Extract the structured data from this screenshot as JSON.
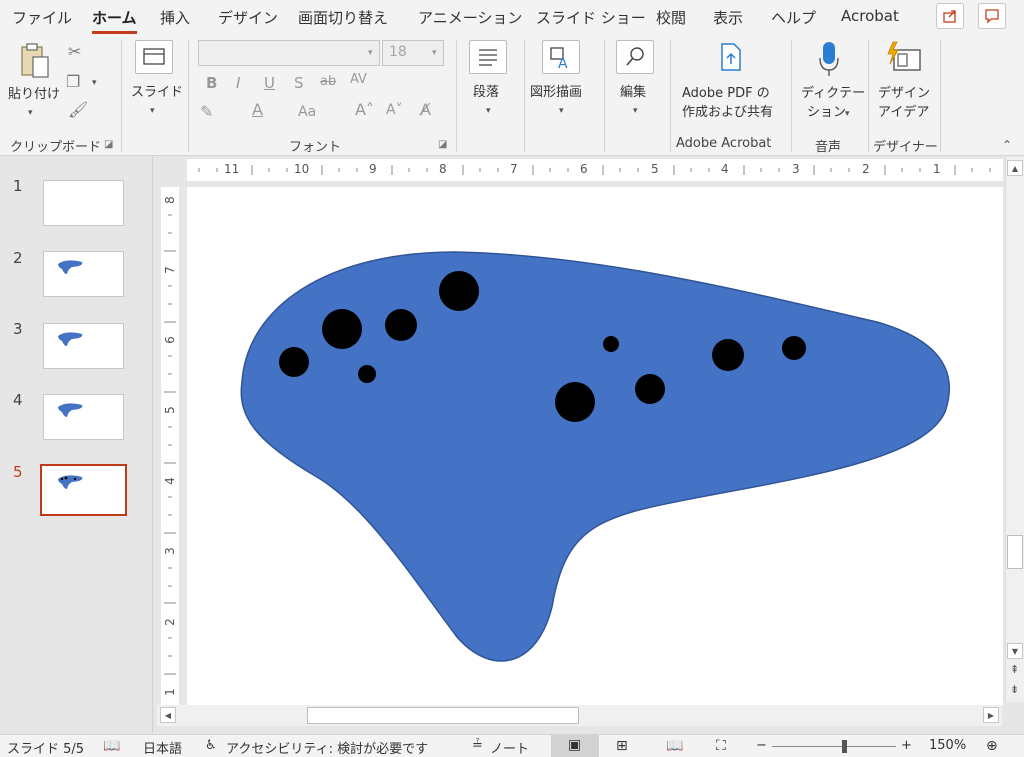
{
  "menu": {
    "tabs": [
      "ファイル",
      "ホーム",
      "挿入",
      "デザイン",
      "画面切り替え",
      "アニメーション",
      "スライド ショー",
      "校閲",
      "表示",
      "ヘルプ",
      "Acrobat"
    ],
    "active_tab": "ホーム"
  },
  "ribbon": {
    "clipboard": {
      "paste_label": "貼り付け",
      "group_label": "クリップボード"
    },
    "slides": {
      "slide_label": "スライド"
    },
    "font": {
      "font_name": "",
      "font_size": "18",
      "group_label": "フォント",
      "size_label": "Aa"
    },
    "paragraph": {
      "label": "段落"
    },
    "drawing": {
      "label": "図形描画"
    },
    "editing": {
      "label": "編集"
    },
    "acrobat": {
      "line1": "Adobe PDF の",
      "line2": "作成および共有",
      "group_label": "Adobe Acrobat"
    },
    "voice": {
      "line1": "ディクテー",
      "line2": "ション",
      "group_label": "音声"
    },
    "designer": {
      "line1": "デザイン",
      "line2": "アイデア",
      "group_label": "デザイナー"
    }
  },
  "thumbnails": [
    {
      "number": "1",
      "has_shape": false
    },
    {
      "number": "2",
      "has_shape": true
    },
    {
      "number": "3",
      "has_shape": true
    },
    {
      "number": "4",
      "has_shape": true
    },
    {
      "number": "5",
      "has_shape": true,
      "selected": true
    }
  ],
  "ruler": {
    "horizontal": [
      "11",
      "10",
      "9",
      "8",
      "7",
      "6",
      "5",
      "4",
      "3",
      "2",
      "1"
    ],
    "vertical": [
      "8",
      "7",
      "6",
      "5",
      "4",
      "3",
      "2",
      "1"
    ]
  },
  "slide": {
    "shape_fill": "#4472c4",
    "shape_stroke": "#2f5597",
    "hole_color": "#000000"
  },
  "status": {
    "slide_counter": "スライド 5/5",
    "language": "日本語",
    "accessibility": "アクセシビリティ: 検討が必要です",
    "notes": "ノート",
    "zoom_minus": "−",
    "zoom_plus": "+",
    "zoom": "150%"
  }
}
